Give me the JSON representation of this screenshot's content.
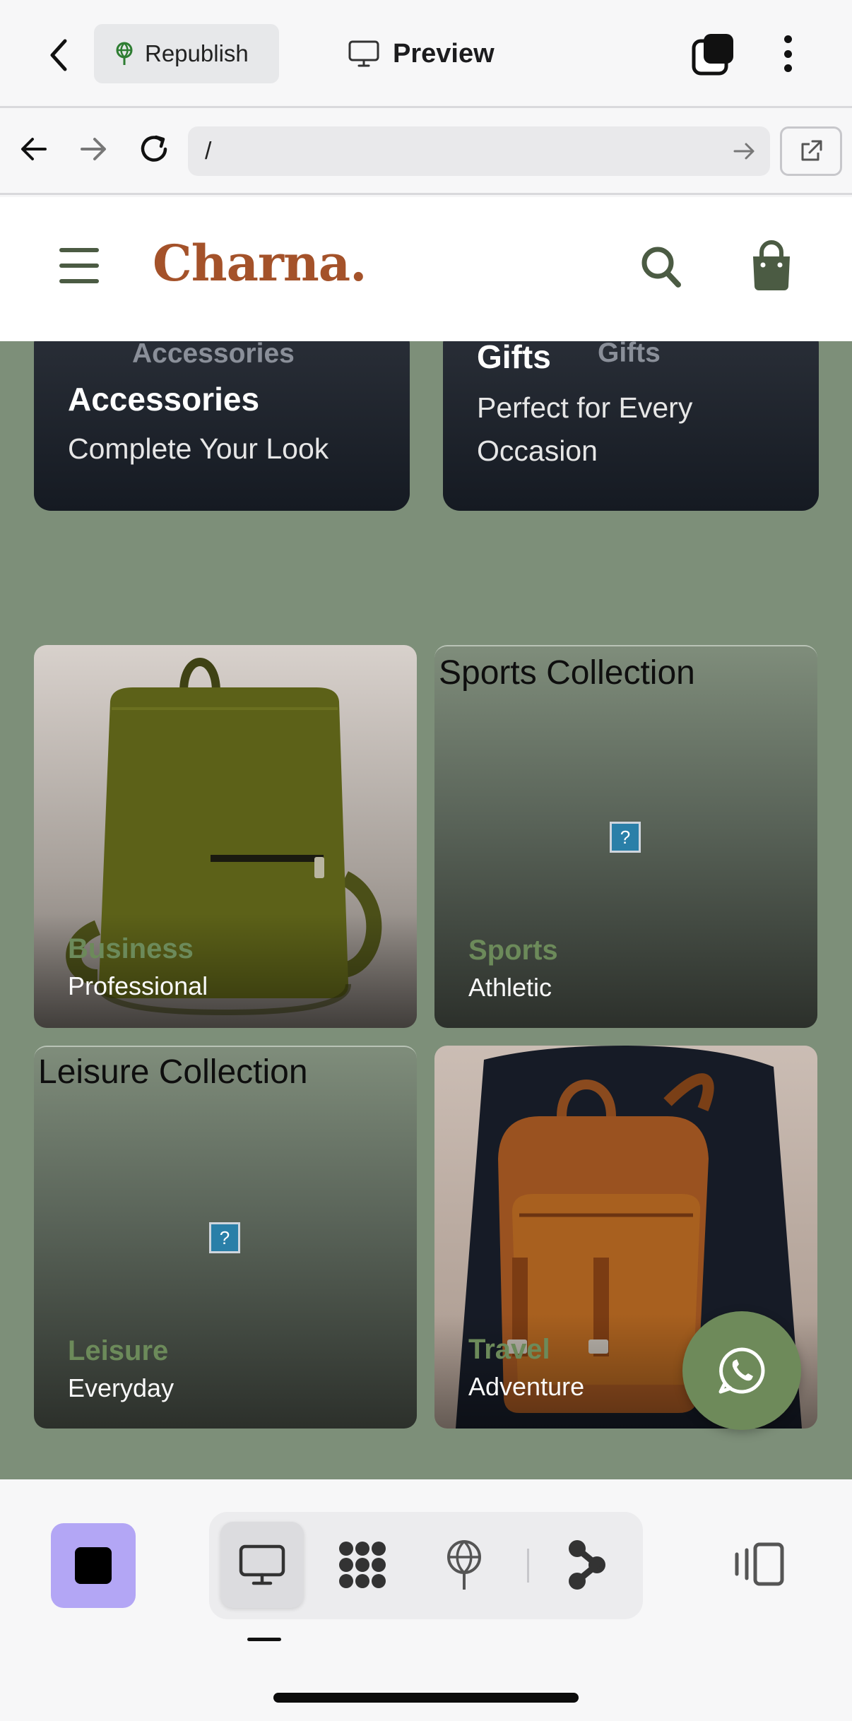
{
  "topbar": {
    "republish_label": "Republish",
    "preview_label": "Preview"
  },
  "browser": {
    "url": "/"
  },
  "site": {
    "brand": "Charna."
  },
  "cards": [
    {
      "ghost": "Accessories",
      "title": "Accessories",
      "subtitle": "Complete Your Look"
    },
    {
      "ghost": "Gifts",
      "title": "Gifts",
      "subtitle": "Perfect for Every Occasion"
    }
  ],
  "tiles": [
    {
      "outside_title": "",
      "category": "Business",
      "subtitle": "Professional",
      "image": "olive-green-backpack"
    },
    {
      "outside_title": "Sports Collection",
      "category": "Sports",
      "subtitle": "Athletic",
      "image": "broken-image"
    },
    {
      "outside_title": "Leisure Collection",
      "category": "Leisure",
      "subtitle": "Everyday",
      "image": "broken-image"
    },
    {
      "outside_title": "",
      "category": "Travel",
      "subtitle": "Adventure",
      "image": "brown-leather-backpack"
    }
  ],
  "broken_image_glyph": "?",
  "colors": {
    "brand": "#a4522a",
    "content_bg": "#7d8f79",
    "accent_green": "#6e8a5a",
    "stop_button": "#b3a6f5"
  },
  "icons": {
    "back": "chevron-left-icon",
    "republish": "tree-globe-icon",
    "preview": "monitor-icon",
    "stack": "stacked-squares-icon",
    "more": "kebab-icon",
    "site_search": "search-icon",
    "site_bag": "shopping-bag-icon",
    "fab": "whatsapp-icon"
  }
}
